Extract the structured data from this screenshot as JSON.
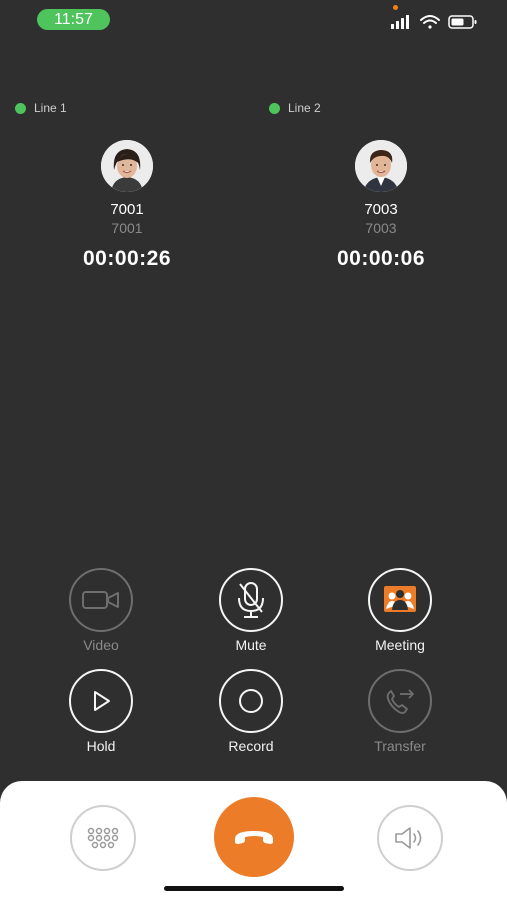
{
  "status": {
    "time": "11:57"
  },
  "lines": [
    {
      "label": "Line 1",
      "number": "7001",
      "sub_number": "7001",
      "duration": "00:00:26"
    },
    {
      "label": "Line 2",
      "number": "7003",
      "sub_number": "7003",
      "duration": "00:00:06"
    }
  ],
  "controls": {
    "video": "Video",
    "mute": "Mute",
    "meeting": "Meeting",
    "hold": "Hold",
    "record": "Record",
    "transfer": "Transfer"
  },
  "colors": {
    "accent": "#ed7c28",
    "active_green": "#4fc35c",
    "background": "#2f2f30"
  }
}
